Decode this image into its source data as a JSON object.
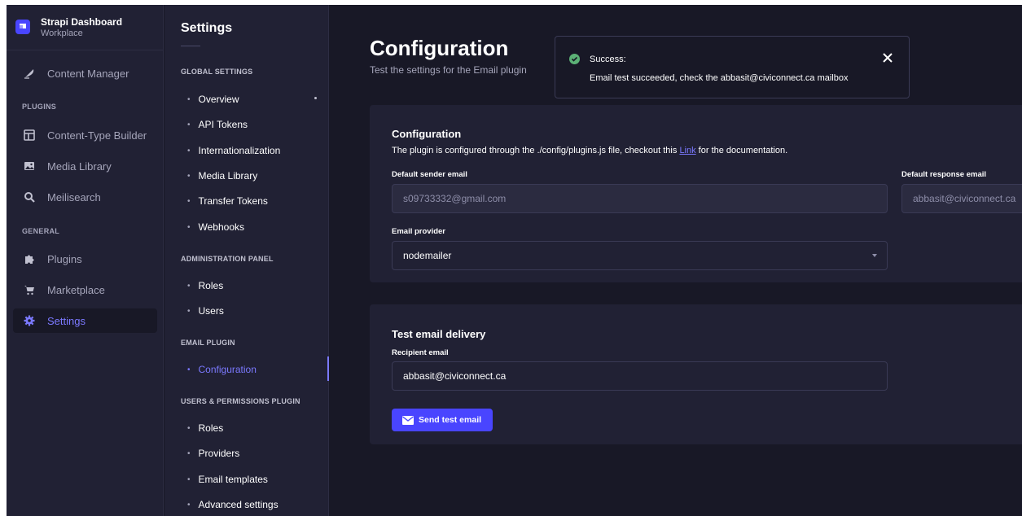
{
  "brand": {
    "title": "Strapi Dashboard",
    "subtitle": "Workplace"
  },
  "nav": {
    "content_manager": "Content Manager",
    "plugins_section": "PLUGINS",
    "content_type_builder": "Content-Type Builder",
    "media_library": "Media Library",
    "meilisearch": "Meilisearch",
    "general_section": "GENERAL",
    "plugins": "Plugins",
    "marketplace": "Marketplace",
    "settings": "Settings"
  },
  "subnav": {
    "title": "Settings",
    "global_section": "GLOBAL SETTINGS",
    "overview": "Overview",
    "api_tokens": "API Tokens",
    "internationalization": "Internationalization",
    "media_library": "Media Library",
    "transfer_tokens": "Transfer Tokens",
    "webhooks": "Webhooks",
    "admin_section": "ADMINISTRATION PANEL",
    "roles": "Roles",
    "users": "Users",
    "email_section": "EMAIL PLUGIN",
    "configuration": "Configuration",
    "up_section": "USERS & PERMISSIONS PLUGIN",
    "up_roles": "Roles",
    "providers": "Providers",
    "email_templates": "Email templates",
    "advanced_settings": "Advanced settings"
  },
  "page": {
    "title": "Configuration",
    "subtitle": "Test the settings for the Email plugin"
  },
  "config_panel": {
    "title": "Configuration",
    "desc_before": "The plugin is configured through the ./config/plugins.js file, checkout this ",
    "desc_link": "Link",
    "desc_after": " for the documentation.",
    "sender_label": "Default sender email",
    "sender_value": "s09733332@gmail.com",
    "response_label": "Default response email",
    "response_value": "abbasit@civiconnect.ca",
    "provider_label": "Email provider",
    "provider_value": "nodemailer"
  },
  "test_panel": {
    "title": "Test email delivery",
    "recipient_label": "Recipient email",
    "recipient_value": "abbasit@civiconnect.ca",
    "send_button": "Send test email"
  },
  "toast": {
    "title": "Success:",
    "message": "Email test succeeded, check the abbasit@civiconnect.ca mailbox"
  },
  "colors": {
    "accent": "#4945ff",
    "accent_text": "#7b79ff",
    "success": "#5cb176",
    "background": "#181826",
    "panel": "#212134"
  },
  "icons": [
    "strapi-logo-icon",
    "feather-icon",
    "layout-icon",
    "image-icon",
    "search-icon",
    "puzzle-icon",
    "cart-icon",
    "cog-icon",
    "mail-icon",
    "check-icon",
    "close-icon",
    "chevron-down-icon"
  ]
}
